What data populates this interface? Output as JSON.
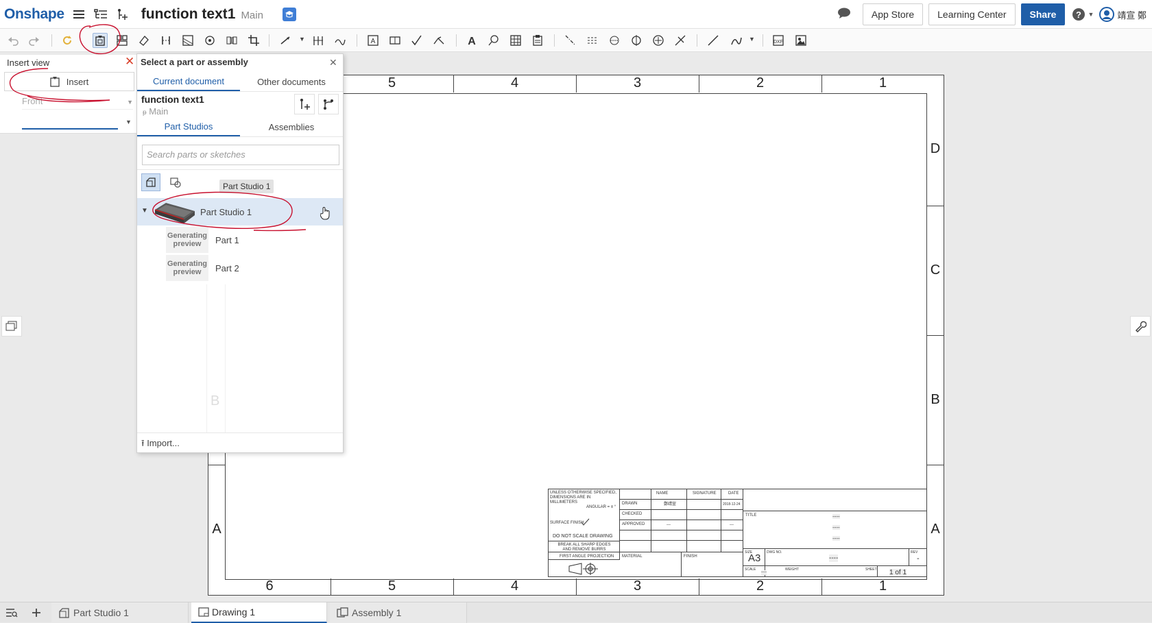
{
  "header": {
    "logo": "Onshape",
    "doc_title": "function text1",
    "doc_branch": "Main",
    "app_store": "App Store",
    "learning_center": "Learning Center",
    "share": "Share",
    "user_name": "靖宣 鄭"
  },
  "insert_panel": {
    "title": "Insert view",
    "insert_label": "Insert",
    "view_select": "Front"
  },
  "select_dialog": {
    "title": "Select a part or assembly",
    "tab_current": "Current document",
    "tab_other": "Other documents",
    "doc_name": "function text1",
    "doc_branch": "Main",
    "tab_part_studios": "Part Studios",
    "tab_assemblies": "Assemblies",
    "search_placeholder": "Search parts or sketches",
    "tooltip": "Part Studio 1",
    "items": [
      {
        "label": "Part Studio 1"
      },
      {
        "label": "Part 1",
        "preview": "Generating preview"
      },
      {
        "label": "Part 2",
        "preview": "Generating preview"
      }
    ],
    "import_label": "Import...",
    "ghost_letter": "B"
  },
  "sheet": {
    "top_numbers": [
      "5",
      "4",
      "3",
      "2",
      "1"
    ],
    "bottom_numbers": [
      "6",
      "5",
      "4",
      "3",
      "2",
      "1"
    ],
    "right_letters": [
      "D",
      "C",
      "B",
      "A"
    ],
    "left_letters": [
      "A"
    ],
    "title_block": {
      "unless": "UNLESS OTHERWISE SPECIFIED, DIMENSIONS ARE IN MILLIMETERS",
      "angular": "ANGULAR = ± °",
      "surface_finish": "SURFACE FINISH",
      "do_not_scale": "DO NOT SCALE DRAWING",
      "break_edges": "BREAK ALL SHARP EDGES AND REMOVE BURRS",
      "projection": "FIRST ANGLE PROJECTION",
      "name_hdr": "NAME",
      "sig_hdr": "SIGNATURE",
      "date_hdr": "DATE",
      "drawn": "DRAWN",
      "checked": "CHECKED",
      "approved": "APPROVED",
      "drawn_name": "鄭靖宣",
      "drawn_date": "2018-12-24",
      "dash_small": "---",
      "material": "MATERIAL",
      "finish": "FINISH",
      "title": "TITLE",
      "dashes": "----",
      "size_lbl": "SIZE",
      "size": "A3",
      "dwg_no": "DWG NO.",
      "rev_lbl": "REV",
      "rev": "-",
      "scale_lbl": "SCALE",
      "weight_lbl": "WEIGHT",
      "sheet_lbl": "SHEET",
      "sheet_of": "1 of 1"
    }
  },
  "bottom_tabs": [
    {
      "label": "Part Studio 1"
    },
    {
      "label": "Drawing 1"
    },
    {
      "label": "Assembly 1"
    }
  ],
  "colors": {
    "brand": "#1f5ea8",
    "annotation_red": "#c8102e",
    "close_red": "#d9412b"
  }
}
